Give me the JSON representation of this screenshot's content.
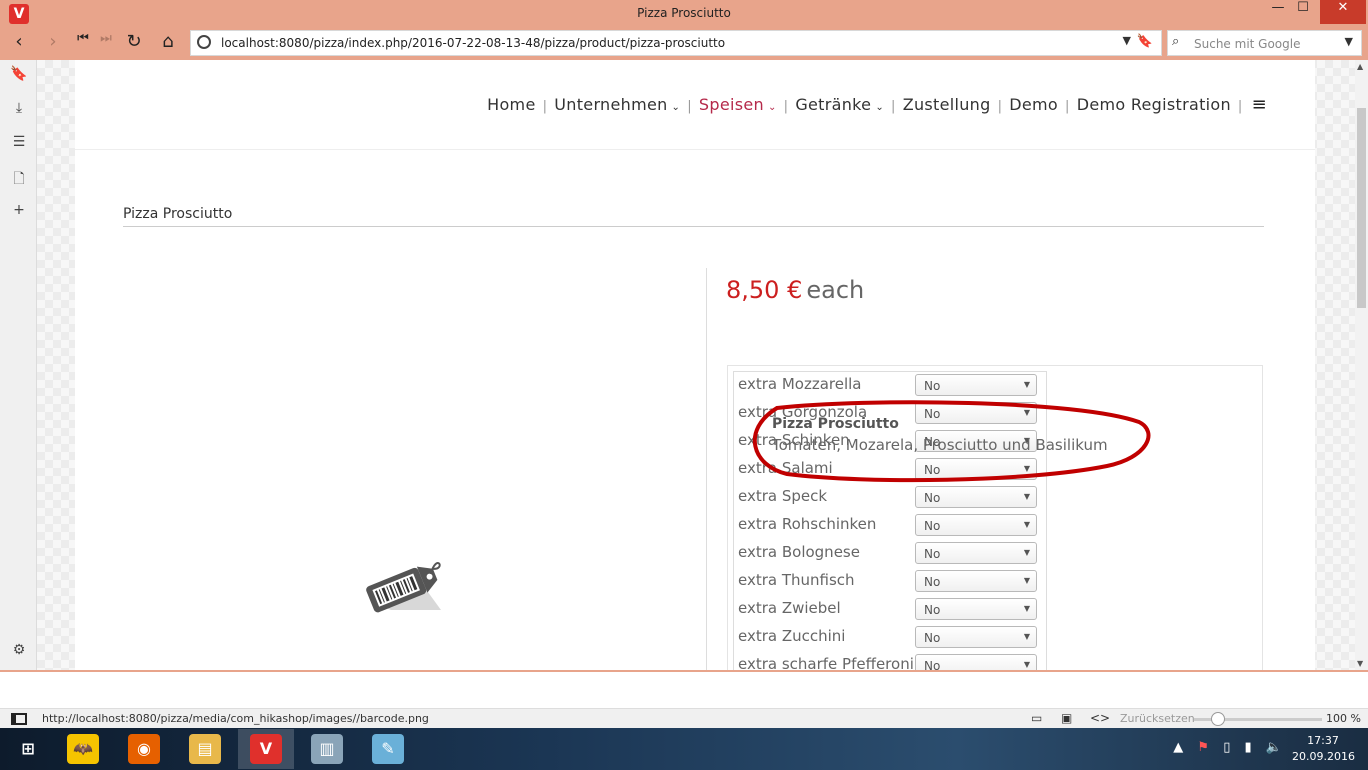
{
  "window": {
    "title": "Pizza Prosciutto",
    "app_logo": "V"
  },
  "window_controls": {
    "minimize": "—",
    "maximize": "☐",
    "close": "✕"
  },
  "navigation": {
    "back": "‹",
    "forward": "›",
    "rewind": "⏮",
    "fastforward": "⏭",
    "reload": "↻",
    "home": "⌂",
    "url": "localhost:8080/pizza/index.php/2016-07-22-08-13-48/pizza/product/pizza-prosciutto",
    "dropdown": "▼",
    "bookmark": "🔖",
    "search_placeholder": "Suche mit Google",
    "search_dropdown": "▼"
  },
  "sidebar": {
    "items": [
      {
        "name": "bookmarks-icon",
        "glyph": "🔖"
      },
      {
        "name": "downloads-icon",
        "glyph": "⤓"
      },
      {
        "name": "notes-icon",
        "glyph": "☰"
      },
      {
        "name": "page-icon",
        "glyph": "🗋"
      },
      {
        "name": "add-panel-icon",
        "glyph": "+"
      }
    ],
    "settings_glyph": "⚙"
  },
  "site_menu": {
    "items": [
      {
        "label": "Home",
        "dropdown": false,
        "active": false
      },
      {
        "label": "Unternehmen",
        "dropdown": true,
        "active": false
      },
      {
        "label": "Speisen",
        "dropdown": true,
        "active": true
      },
      {
        "label": "Getränke",
        "dropdown": true,
        "active": false
      },
      {
        "label": "Zustellung",
        "dropdown": false,
        "active": false
      },
      {
        "label": "Demo",
        "dropdown": false,
        "active": false
      },
      {
        "label": "Demo Registration",
        "dropdown": false,
        "active": false
      }
    ],
    "separator": "|",
    "caret": "⌄",
    "hamburger": "≡"
  },
  "product": {
    "title": "Pizza Prosciutto",
    "price": "8,50 €",
    "price_unit": "each",
    "options": [
      {
        "label": "extra Mozzarella",
        "value": "No"
      },
      {
        "label": "extra Gorgonzola",
        "value": "No"
      },
      {
        "label": "extra Schinken",
        "value": "No"
      },
      {
        "label": "extra Salami",
        "value": "No"
      },
      {
        "label": "extra Speck",
        "value": "No"
      },
      {
        "label": "extra Rohschinken",
        "value": "No"
      },
      {
        "label": "extra Bolognese",
        "value": "No"
      },
      {
        "label": "extra Thunfisch",
        "value": "No"
      },
      {
        "label": "extra Zwiebel",
        "value": "No"
      },
      {
        "label": "extra Zucchini",
        "value": "No"
      },
      {
        "label": "extra scharfe Pfefferoni",
        "value": "No"
      }
    ],
    "select_arrow": "▼",
    "tooltip": {
      "name": "Pizza Prosciutto",
      "description": "Tomaten, Mozarela, Prosciutto und Basilikum"
    },
    "annotation_color": "#c00000"
  },
  "scrollbar": {
    "up": "▲",
    "down": "▼"
  },
  "statusbar": {
    "link": "http://localhost:8080/pizza/media/com_hikashop/images//barcode.png",
    "reset": "Zurücksetzen",
    "zoom": "100 %",
    "icons": {
      "page": "▭",
      "image": "▣",
      "code": "<>"
    }
  },
  "taskbar": {
    "apps": [
      {
        "name": "start-button",
        "glyph": "⊞",
        "color": "transparent"
      },
      {
        "name": "batman-app",
        "glyph": "🦇",
        "color": "#f5c400"
      },
      {
        "name": "firefox-app",
        "glyph": "◉",
        "color": "#e66000"
      },
      {
        "name": "explorer-app",
        "glyph": "▤",
        "color": "#e8b84a"
      },
      {
        "name": "vivaldi-app",
        "glyph": "V",
        "color": "#e0302c"
      },
      {
        "name": "monitor-app",
        "glyph": "▥",
        "color": "#8aa4b8"
      },
      {
        "name": "notepad-app",
        "glyph": "✎",
        "color": "#6ab0d8"
      }
    ],
    "tray": {
      "up": "▲",
      "flag": "⚑",
      "battery": "▯",
      "signal": "▮",
      "volume": "🔈"
    },
    "time": "17:37",
    "date": "20.09.2016"
  },
  "colors": {
    "chrome": "#e8a48b",
    "accent": "#cc1f1f",
    "menu_active": "#b5294a"
  }
}
